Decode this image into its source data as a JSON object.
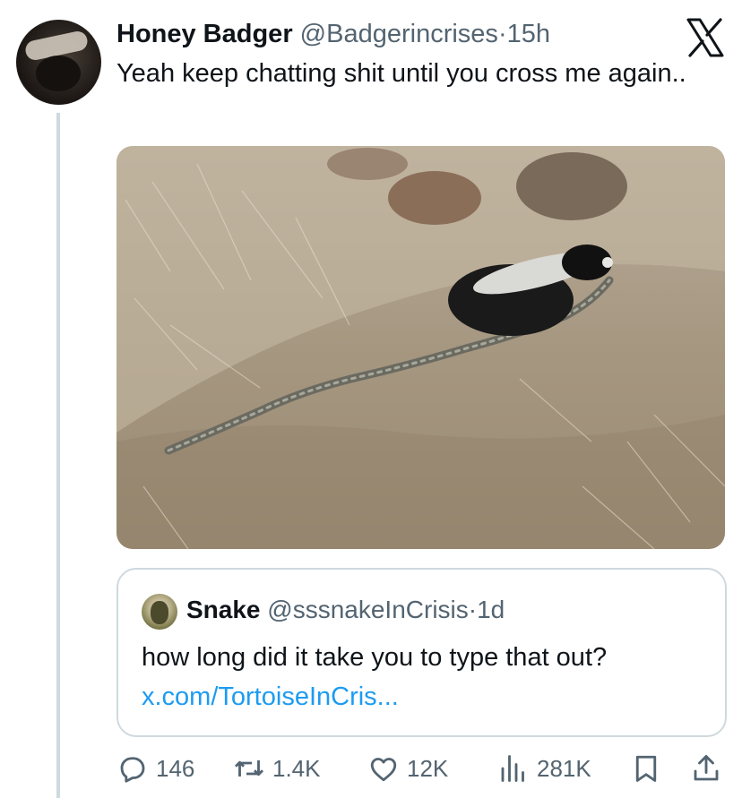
{
  "tweet": {
    "author_name": "Honey Badger",
    "author_handle": "@Badgerincrises",
    "separator": "·",
    "time": "15h",
    "text": "Yeah keep chatting shit until you cross me again..",
    "image": "honey badger dragging a long snake across dry grass"
  },
  "quote": {
    "author_name": "Snake",
    "author_handle": "@sssnakeInCrisis",
    "separator": "·",
    "time": "1d",
    "text": "how long did it take you to type that out?",
    "link": "x.com/TortoiseInCris..."
  },
  "actions": {
    "replies": "146",
    "reposts": "1.4K",
    "likes": "12K",
    "views": "281K"
  },
  "icons": {
    "platform": "x-logo-icon",
    "reply": "reply-icon",
    "repost": "repost-icon",
    "like": "heart-icon",
    "views": "views-icon",
    "bookmark": "bookmark-icon",
    "share": "share-icon"
  },
  "colors": {
    "link": "#1d9bf0",
    "muted": "#536471",
    "border": "#cfd9de"
  }
}
